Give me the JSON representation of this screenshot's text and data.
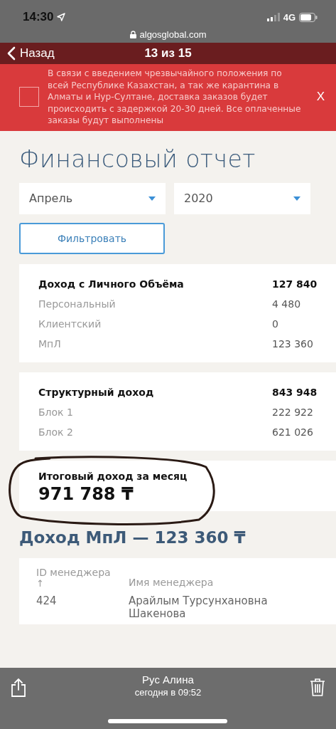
{
  "status_bar": {
    "time": "14:30",
    "network": "4G"
  },
  "browser": {
    "url": "algosglobal.com"
  },
  "viewer_nav": {
    "back": "Назад",
    "counter": "13 из 15"
  },
  "notice": {
    "checked": false,
    "text": "В связи с введением чрезвычайного положения по всей Республике Казахстан, а так же карантина в Алматы и Нур-Султане, доставка заказов будет происходить с задержкой 20-30 дней. Все оплаченные заказы будут выполнены",
    "close": "X"
  },
  "page": {
    "title": "Финансовый отчет",
    "filters": [
      {
        "value": "Апрель"
      },
      {
        "value": "2020"
      }
    ],
    "filter_button": "Фильтровать",
    "income_groups": [
      {
        "title": "Доход с Личного Объёма",
        "total": "127 840",
        "items": [
          {
            "label": "Персональный",
            "value": "4 480"
          },
          {
            "label": "Клиентский",
            "value": "0"
          },
          {
            "label": "МпЛ",
            "value": "123 360"
          }
        ]
      },
      {
        "title": "Структурный доход",
        "total": "843 948",
        "items": [
          {
            "label": "Блок 1",
            "value": "222 922"
          },
          {
            "label": "Блок 2",
            "value": "621 026"
          }
        ]
      }
    ],
    "monthly_total": {
      "label": "Итоговый доход за месяц",
      "value": "971 788 ₸"
    },
    "mpl_heading": "Доход МпЛ — 123 360 ₸",
    "table": {
      "columns": [
        {
          "label": "ID менеджера",
          "sort_arrow": "↑"
        },
        {
          "label": "Имя менеджера"
        }
      ],
      "rows": [
        [
          "424",
          "Арайлым Турсунхановна Шакенова"
        ]
      ]
    }
  },
  "viewer_toolbar": {
    "sender": "Рус Алина",
    "time": "сегодня в 09:52"
  }
}
